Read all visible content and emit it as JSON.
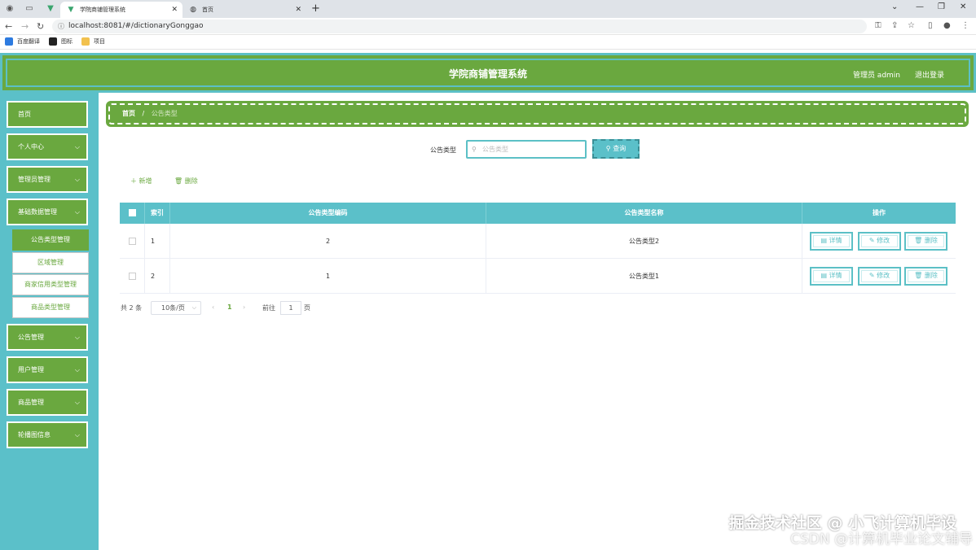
{
  "browser": {
    "tabs": [
      {
        "title": "学院商铺管理系统",
        "active": true
      },
      {
        "title": "首页",
        "active": false
      }
    ],
    "url": "localhost:8081/#/dictionaryGonggao",
    "bookmarks": [
      "百度翻译",
      "图标",
      "项目"
    ]
  },
  "header": {
    "title": "学院商铺管理系统",
    "user": "管理员 admin",
    "logout": "退出登录"
  },
  "sidebar": {
    "items": [
      {
        "label": "首页",
        "has_arrow": false
      },
      {
        "label": "个人中心",
        "has_arrow": true
      },
      {
        "label": "管理员管理",
        "has_arrow": true
      },
      {
        "label": "基础数据管理",
        "has_arrow": true,
        "expanded": true
      },
      {
        "label": "公告管理",
        "has_arrow": true
      },
      {
        "label": "用户管理",
        "has_arrow": true
      },
      {
        "label": "商品管理",
        "has_arrow": true
      },
      {
        "label": "轮播图信息",
        "has_arrow": true
      }
    ],
    "sub_items": [
      {
        "label": "公告类型管理",
        "active": true
      },
      {
        "label": "区域管理",
        "active": false
      },
      {
        "label": "商家信用类型管理",
        "active": false
      },
      {
        "label": "商品类型管理",
        "active": false
      }
    ]
  },
  "breadcrumb": {
    "home": "首页",
    "separator": "/",
    "current": "公告类型"
  },
  "search": {
    "label": "公告类型",
    "placeholder": "公告类型",
    "button": "查询"
  },
  "actions": {
    "add": "新增",
    "delete": "删除"
  },
  "table": {
    "columns": [
      "索引",
      "公告类型编码",
      "公告类型名称",
      "操作"
    ],
    "rows": [
      {
        "index": "1",
        "code": "2",
        "name": "公告类型2"
      },
      {
        "index": "2",
        "code": "1",
        "name": "公告类型1"
      }
    ],
    "row_actions": {
      "detail": "详情",
      "edit": "修改",
      "delete": "删除"
    }
  },
  "pagination": {
    "total": "共 2 条",
    "page_size": "10条/页",
    "current_page": "1",
    "goto_label": "前往",
    "goto_value": "1",
    "goto_unit": "页"
  },
  "watermark": {
    "line1": "掘金技术社区 @ 小飞计算机毕设",
    "line2": "CSDN @计算机毕业论文辅导"
  },
  "colors": {
    "primary_green": "#6aa83f",
    "accent_teal": "#5bc0c9"
  }
}
